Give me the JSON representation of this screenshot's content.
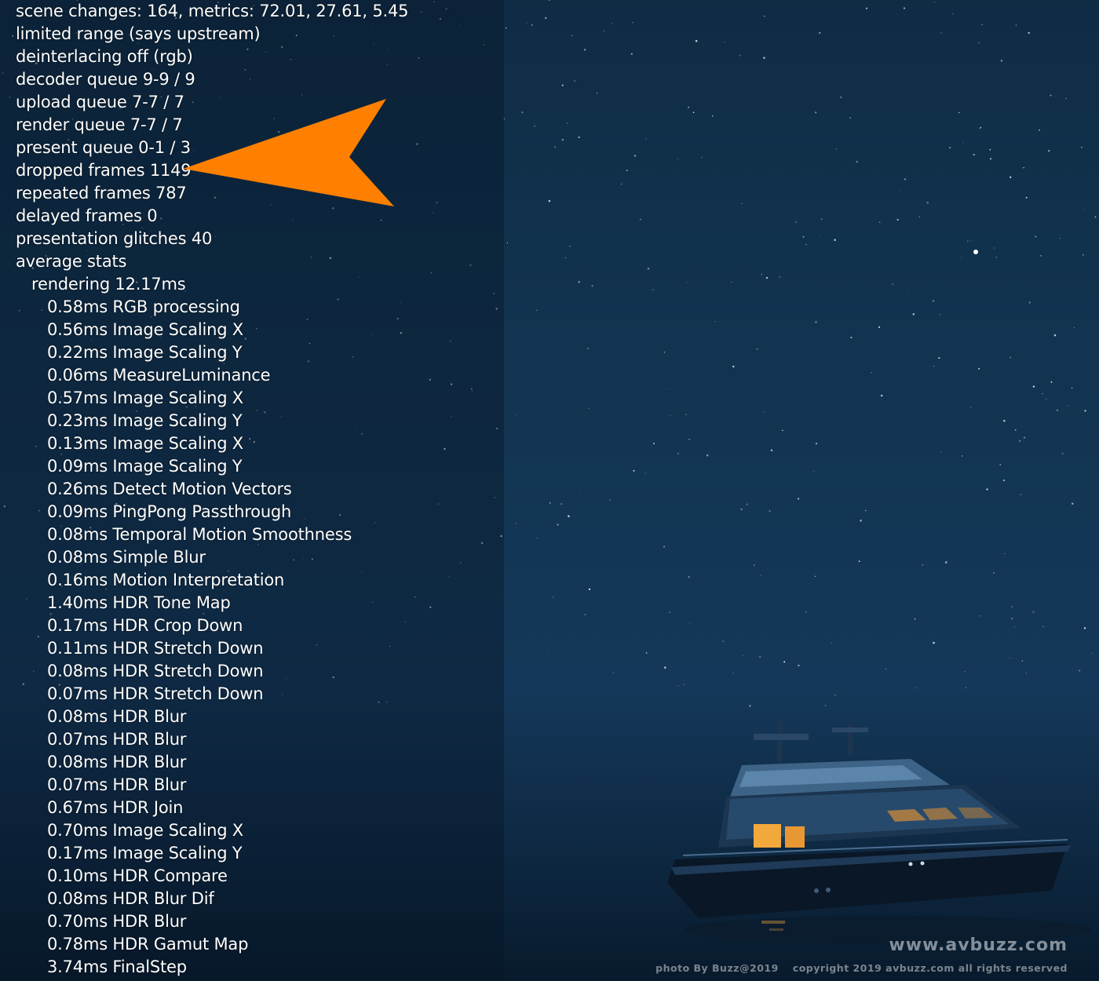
{
  "osd": {
    "lines": [
      "scene changes: 164, metrics: 72.01, 27.61, 5.45",
      "limited range (says upstream)",
      "deinterlacing off (rgb)",
      "decoder queue 9-9 / 9",
      "upload queue 7-7 / 7",
      "render queue 7-7 / 7",
      "present queue 0-1 / 3",
      "dropped frames 1149",
      "repeated frames 787",
      "delayed frames 0",
      "presentation glitches 40",
      "average stats",
      "rendering 12.17ms",
      "0.58ms RGB processing",
      "0.56ms Image Scaling X",
      "0.22ms Image Scaling Y",
      "0.06ms MeasureLuminance",
      "0.57ms Image Scaling X",
      "0.23ms Image Scaling Y",
      "0.13ms Image Scaling X",
      "0.09ms Image Scaling Y",
      "0.26ms Detect Motion Vectors",
      "0.09ms PingPong Passthrough",
      "0.08ms Temporal Motion Smoothness",
      "0.08ms Simple Blur",
      "0.16ms Motion Interpretation",
      "1.40ms HDR Tone Map",
      "0.17ms HDR Crop Down",
      "0.11ms HDR Stretch Down",
      "0.08ms HDR Stretch Down",
      "0.07ms HDR Stretch Down",
      "0.08ms HDR Blur",
      "0.07ms HDR Blur",
      "0.08ms HDR Blur",
      "0.07ms HDR Blur",
      "0.67ms HDR Join",
      "0.70ms Image Scaling X",
      "0.17ms Image Scaling Y",
      "0.10ms HDR Compare",
      "0.08ms HDR Blur Dif",
      "0.70ms HDR Blur",
      "0.78ms HDR Gamut Map",
      "3.74ms FinalStep"
    ]
  },
  "watermark": {
    "site": "www.avbuzz.com",
    "photo_credit": "photo By Buzz@2019",
    "copyright": "copyright 2019 avbuzz.com all rights reserved"
  },
  "colors": {
    "annotation_arrow": "#ff8000",
    "osd_text": "#ffffff",
    "night_sky": "#123450",
    "cabin_light": "#f2a93b"
  },
  "icons": {
    "annotation": "arrow-pointer-icon",
    "photo_subject": "yacht"
  }
}
